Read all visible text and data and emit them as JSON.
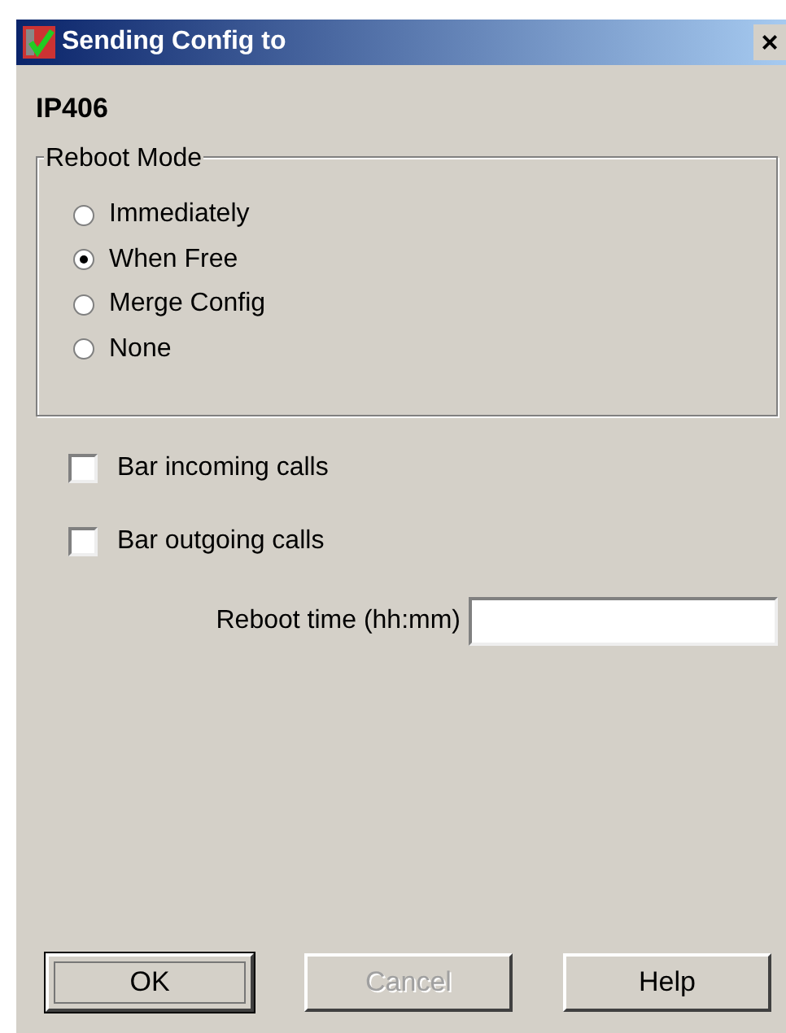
{
  "window": {
    "title": "Sending Config to",
    "close": "×"
  },
  "device": "IP406",
  "reboot_mode": {
    "title": "Reboot Mode",
    "options": [
      {
        "label": "Immediately",
        "selected": false
      },
      {
        "label": "When Free",
        "selected": true
      },
      {
        "label": "Merge Config",
        "selected": false
      },
      {
        "label": "None",
        "selected": false
      }
    ]
  },
  "checkboxes": [
    {
      "label": "Bar incoming calls",
      "checked": false
    },
    {
      "label": "Bar outgoing calls",
      "checked": false
    }
  ],
  "reboot_time": {
    "label": "Reboot time (hh:mm)"
  },
  "buttons": [
    {
      "label": "OK",
      "disabled": false,
      "default": true
    },
    {
      "label": "Cancel",
      "disabled": true,
      "default": false
    },
    {
      "label": "Help",
      "disabled": false,
      "default": false
    }
  ]
}
